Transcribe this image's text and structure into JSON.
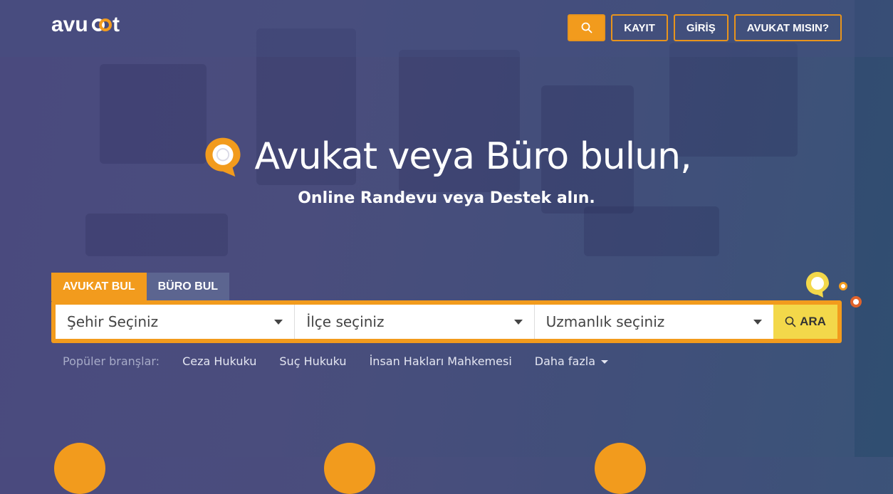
{
  "header": {
    "logo": "avukat",
    "nav": [
      {
        "icon": "search-icon",
        "label": ""
      },
      {
        "label": "KAYIT"
      },
      {
        "label": "GİRİŞ"
      },
      {
        "label": "AVUKAT MISIN?"
      }
    ]
  },
  "hero": {
    "title": "Avukat veya Büro bulun,",
    "subtitle": "Online Randevu veya Destek alın."
  },
  "search": {
    "tabs": [
      {
        "label": "AVUKAT BUL",
        "active": true
      },
      {
        "label": "BÜRO BUL",
        "active": false
      }
    ],
    "fields": [
      {
        "placeholder": "Şehir Seçiniz"
      },
      {
        "placeholder": "İlçe seçiniz"
      },
      {
        "placeholder": "Uzmanlık seçiniz"
      }
    ],
    "button": "ARA"
  },
  "popular": {
    "label": "Popüler branşlar:",
    "items": [
      "Ceza Hukuku",
      "Suç Hukuku",
      "İnsan Hakları Mahkemesi"
    ],
    "more": "Daha fazla"
  },
  "colors": {
    "accent": "#f29b1d",
    "search_button": "#f3d84a"
  }
}
